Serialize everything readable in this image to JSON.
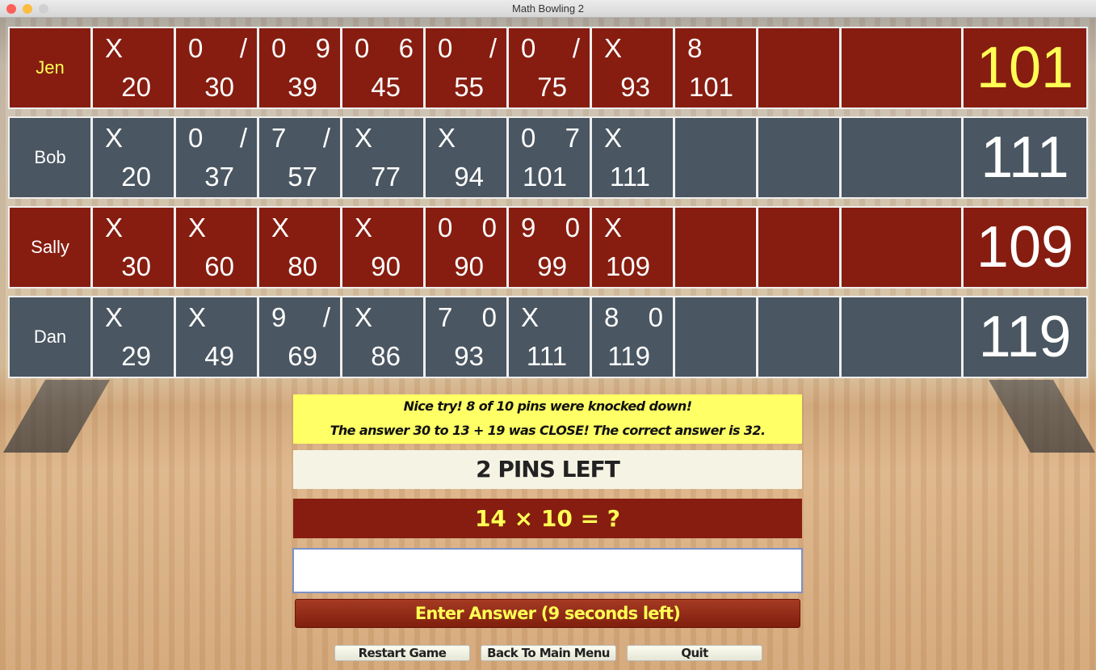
{
  "window": {
    "title": "Math Bowling 2"
  },
  "colors": {
    "red_row": "#861d10",
    "slate_row": "#4a5661",
    "active_name": "#ffff55",
    "message_bg": "#ffff66"
  },
  "players": [
    {
      "name": "Jen",
      "active": true,
      "theme": "red",
      "total": "101",
      "frames": [
        [
          "X",
          "",
          "20"
        ],
        [
          "0",
          "/",
          "30"
        ],
        [
          "0",
          "9",
          "39"
        ],
        [
          "0",
          "6",
          "45"
        ],
        [
          "0",
          "/",
          "55"
        ],
        [
          "0",
          "/",
          "75"
        ],
        [
          "X",
          "",
          "93"
        ],
        [
          "8",
          "",
          "101"
        ],
        [
          "",
          "",
          ""
        ],
        [
          "",
          "",
          ""
        ]
      ]
    },
    {
      "name": "Bob",
      "active": false,
      "theme": "slate",
      "total": "111",
      "frames": [
        [
          "X",
          "",
          "20"
        ],
        [
          "0",
          "/",
          "37"
        ],
        [
          "7",
          "/",
          "57"
        ],
        [
          "X",
          "",
          "77"
        ],
        [
          "X",
          "",
          "94"
        ],
        [
          "0",
          "7",
          "101"
        ],
        [
          "X",
          "",
          "111"
        ],
        [
          "",
          "",
          ""
        ],
        [
          "",
          "",
          ""
        ],
        [
          "",
          "",
          ""
        ]
      ]
    },
    {
      "name": "Sally",
      "active": false,
      "theme": "red",
      "total": "109",
      "frames": [
        [
          "X",
          "",
          "30"
        ],
        [
          "X",
          "",
          "60"
        ],
        [
          "X",
          "",
          "80"
        ],
        [
          "X",
          "",
          "90"
        ],
        [
          "0",
          "0",
          "90"
        ],
        [
          "9",
          "0",
          "99"
        ],
        [
          "X",
          "",
          "109"
        ],
        [
          "",
          "",
          ""
        ],
        [
          "",
          "",
          ""
        ],
        [
          "",
          "",
          ""
        ]
      ]
    },
    {
      "name": "Dan",
      "active": false,
      "theme": "slate",
      "total": "119",
      "frames": [
        [
          "X",
          "",
          "29"
        ],
        [
          "X",
          "",
          "49"
        ],
        [
          "9",
          "/",
          "69"
        ],
        [
          "X",
          "",
          "86"
        ],
        [
          "7",
          "0",
          "93"
        ],
        [
          "X",
          "",
          "111"
        ],
        [
          "8",
          "0",
          "119"
        ],
        [
          "",
          "",
          ""
        ],
        [
          "",
          "",
          ""
        ],
        [
          "",
          "",
          ""
        ]
      ]
    }
  ],
  "message": {
    "line1": "Nice try! 8 of 10 pins were knocked down!",
    "line2": "The answer 30 to 13 + 19 was CLOSE! The correct answer is 32."
  },
  "pins_left": "2 PINS LEFT",
  "question": "14 × 10 = ?",
  "answer": {
    "value": "",
    "placeholder": ""
  },
  "enter_button": "Enter Answer (9 seconds left)",
  "buttons": {
    "restart": "Restart Game",
    "main_menu": "Back To Main Menu",
    "quit": "Quit"
  }
}
